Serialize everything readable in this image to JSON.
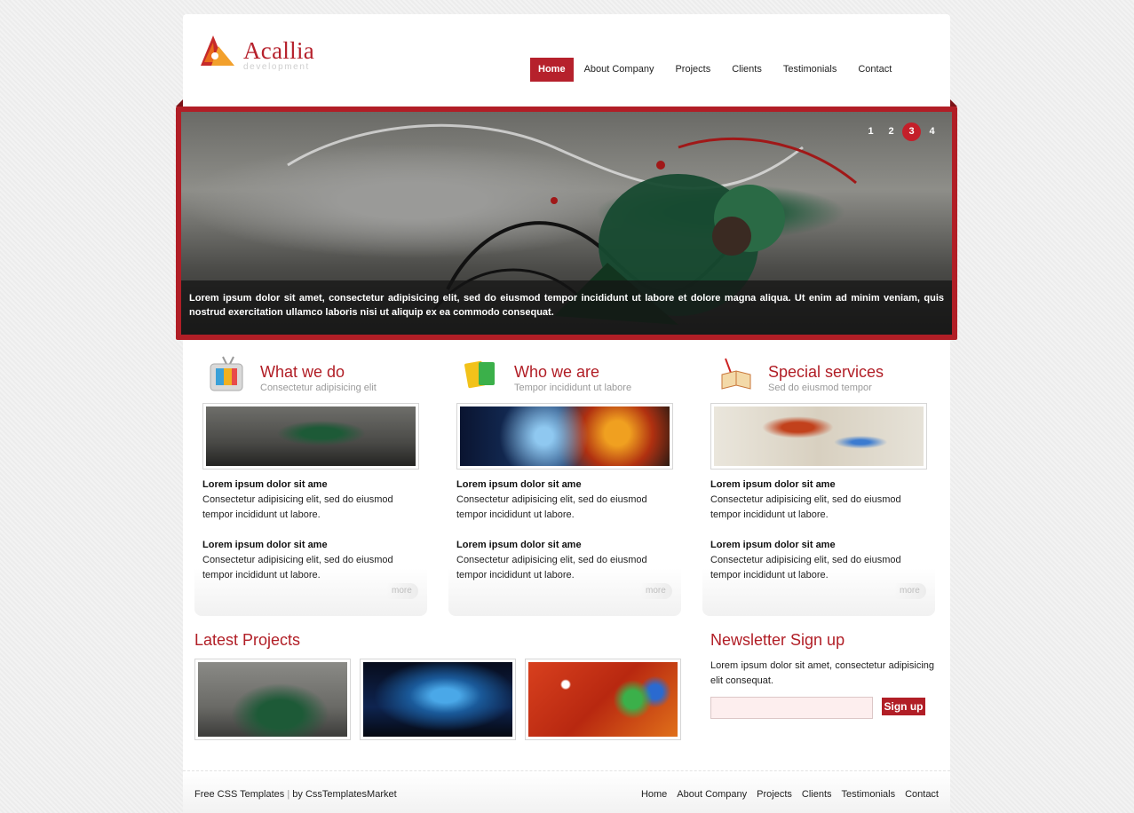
{
  "brand": {
    "name": "Acallia",
    "tagline": "development",
    "colors": {
      "accent": "#b11e26"
    }
  },
  "nav": {
    "items": [
      {
        "label": "Home",
        "active": true
      },
      {
        "label": "About Company"
      },
      {
        "label": "Projects"
      },
      {
        "label": "Clients"
      },
      {
        "label": "Testimonials"
      },
      {
        "label": "Contact"
      }
    ]
  },
  "banner": {
    "caption": "Lorem ipsum dolor sit amet, consectetur adipisicing elit, sed do eiusmod tempor incididunt ut labore et dolore magna aliqua. Ut enim ad minim veniam, quis nostrud exercitation ullamco laboris nisi ut aliquip ex ea commodo consequat.",
    "pages": [
      "1",
      "2",
      "3",
      "4"
    ],
    "current_page": "3"
  },
  "features": [
    {
      "icon": "tv-icon",
      "title": "What we do",
      "subtitle": "Consectetur adipisicing elit",
      "items": [
        {
          "heading": "Lorem ipsum dolor sit ame",
          "text": "Consectetur adipisicing elit, sed do eiusmod tempor incididunt ut labore."
        },
        {
          "heading": "Lorem ipsum dolor sit ame",
          "text": "Consectetur adipisicing elit, sed do eiusmod tempor incididunt ut labore."
        }
      ],
      "more": "more"
    },
    {
      "icon": "folders-icon",
      "title": "Who we are",
      "subtitle": "Tempor incididunt ut labore",
      "items": [
        {
          "heading": "Lorem ipsum dolor sit ame",
          "text": "Consectetur adipisicing elit, sed do eiusmod tempor incididunt ut labore."
        },
        {
          "heading": "Lorem ipsum dolor sit ame",
          "text": "Consectetur adipisicing elit, sed do eiusmod tempor incididunt ut labore."
        }
      ],
      "more": "more"
    },
    {
      "icon": "book-icon",
      "title": "Special services",
      "subtitle": "Sed do eiusmod tempor",
      "items": [
        {
          "heading": "Lorem ipsum dolor sit ame",
          "text": "Consectetur adipisicing elit, sed do eiusmod tempor incididunt ut labore."
        },
        {
          "heading": "Lorem ipsum dolor sit ame",
          "text": "Consectetur adipisicing elit, sed do eiusmod tempor incididunt ut labore."
        }
      ],
      "more": "more"
    }
  ],
  "latest_projects": {
    "title": "Latest Projects"
  },
  "newsletter": {
    "title": "Newsletter Sign up",
    "text": "Lorem ipsum dolor sit amet, consectetur adipisicing elit consequat.",
    "input_value": "",
    "button": "Sign up"
  },
  "footer": {
    "left_text": "Free CSS Templates",
    "separator": "|",
    "by_text": "by CssTemplatesMarket",
    "nav": [
      "Home",
      "About Company",
      "Projects",
      "Clients",
      "Testimonials",
      "Contact"
    ]
  }
}
